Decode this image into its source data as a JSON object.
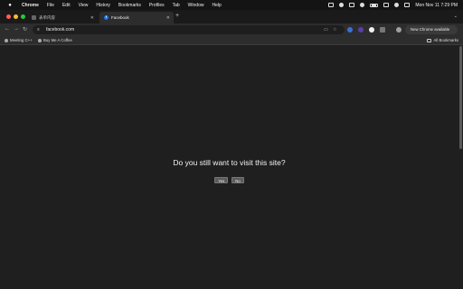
{
  "menubar": {
    "apple_icon": "apple-logo",
    "items": [
      "Chrome",
      "File",
      "Edit",
      "View",
      "History",
      "Bookmarks",
      "Profiles",
      "Tab",
      "Window",
      "Help"
    ],
    "clock": "Mon Nov 11  7:29 PM"
  },
  "tabs": [
    {
      "title": "表单内容",
      "favicon": "page-icon",
      "active": false
    },
    {
      "title": "Facebook",
      "favicon": "facebook-icon",
      "active": true
    }
  ],
  "toolbar": {
    "url": "facebook.com",
    "chrome_available": "New Chrome available"
  },
  "bookmarks": {
    "items": [
      "Meeting C++",
      "Buy Me A Coffee"
    ],
    "all": "All Bookmarks"
  },
  "page": {
    "question": "Do you still want to visit this site?",
    "yes_label": "Yes",
    "no_label": "No"
  },
  "colors": {
    "background": "#1f1f1f",
    "button": "#5b5b5b",
    "facebook_blue": "#1877f2"
  }
}
